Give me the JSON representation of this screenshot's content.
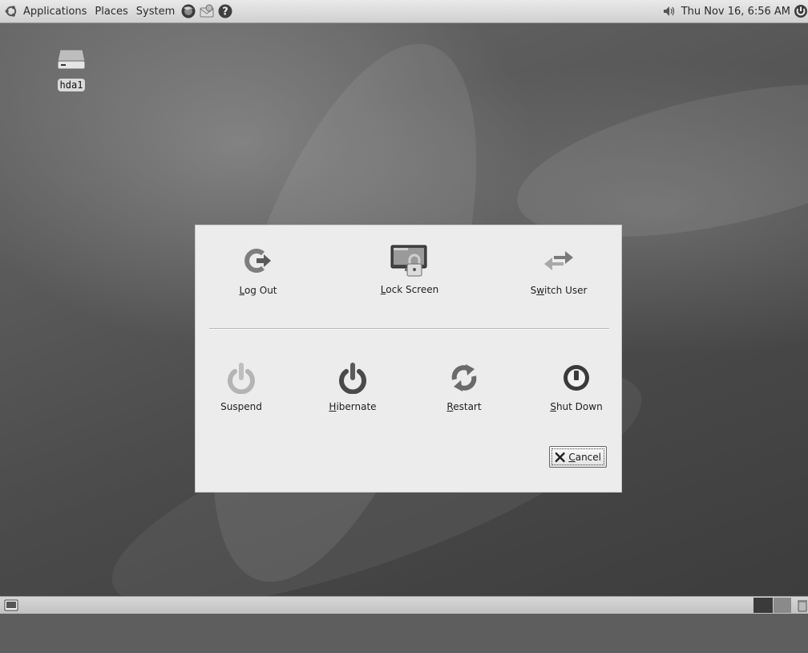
{
  "top_panel": {
    "menus": [
      "Applications",
      "Places",
      "System"
    ],
    "clock": "Thu Nov 16,  6:56 AM"
  },
  "desktop": {
    "icons": [
      {
        "label": "hda1",
        "icon": "drive-icon"
      }
    ]
  },
  "dialog": {
    "top_actions": [
      {
        "label_pre": "",
        "mnemonic": "L",
        "label_post": "og Out",
        "icon": "log-out-icon"
      },
      {
        "label_pre": "",
        "mnemonic": "L",
        "label_post": "ock Screen",
        "icon": "lock-screen-icon"
      },
      {
        "label_pre": "S",
        "mnemonic": "w",
        "label_post": "itch User",
        "icon": "switch-user-icon"
      }
    ],
    "bottom_actions": [
      {
        "label_pre": "Suspend",
        "mnemonic": "",
        "label_post": "",
        "icon": "suspend-icon"
      },
      {
        "label_pre": "",
        "mnemonic": "H",
        "label_post": "ibernate",
        "icon": "hibernate-icon"
      },
      {
        "label_pre": "",
        "mnemonic": "R",
        "label_post": "estart",
        "icon": "restart-icon"
      },
      {
        "label_pre": "",
        "mnemonic": "S",
        "label_post": "hut Down",
        "icon": "shut-down-icon"
      }
    ],
    "cancel": {
      "mnemonic": "C",
      "label_post": "ancel",
      "icon": "cancel-x-icon"
    }
  },
  "colors": {
    "panel": "#d8d8d8",
    "dialog_bg": "#ececec"
  }
}
